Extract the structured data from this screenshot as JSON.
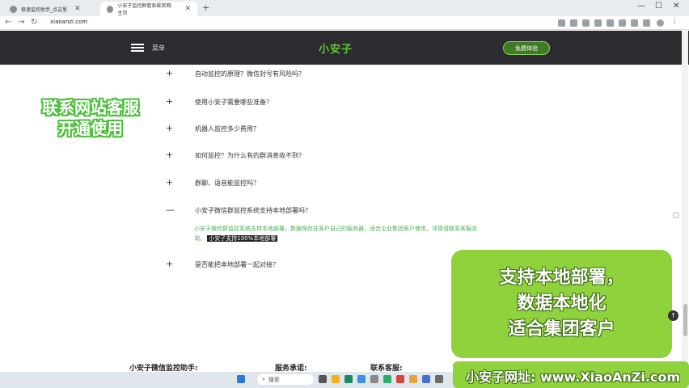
{
  "browser": {
    "tabs": [
      {
        "label": "极速监控助手_点这里"
      },
      {
        "label": "小安子监控群管系统官网-主页"
      }
    ],
    "new_tab": "+",
    "url": "xiaoanzi.com",
    "window_controls": [
      "—",
      "☐",
      "✕"
    ],
    "nav": {
      "back": "←",
      "forward": "→",
      "reload": "↻"
    }
  },
  "header": {
    "menu_label": "菜单",
    "logo": "小安子",
    "cta": "免费体验"
  },
  "faq": [
    {
      "sign": "+",
      "question": "自动监控的原理？微信封号有风险吗？"
    },
    {
      "sign": "+",
      "question": "使用小安子需要哪些准备？"
    },
    {
      "sign": "+",
      "question": "机器人监控多少费用？"
    },
    {
      "sign": "+",
      "question": "如何监控？为什么有的群消息收不到？"
    },
    {
      "sign": "+",
      "question": "群聊、语音能监控吗？"
    },
    {
      "sign": "—",
      "question": "小安子微信群监控系统支持本地部署吗？"
    },
    {
      "sign": "+",
      "question": "是否能把本地部署一起对接？"
    }
  ],
  "answer": {
    "text": "小安子微信群监控系统支持本地部署，数据保存在客户自己的服务器，适合企业集团客户使用，详情请联系客服咨询。",
    "highlight": "小安子支持100%本地部署"
  },
  "promo_left": [
    "联系网站客服",
    "开通使用"
  ],
  "promo_right": [
    "支持本地部署，",
    "数据本地化",
    "适合集团客户"
  ],
  "footer": {
    "col1": "小安子微信监控助手:",
    "col2": "服务承诺:",
    "col3": "联系客服:"
  },
  "taskbar": {
    "search_placeholder": "搜索"
  },
  "url_banner": "小安子网址: www.XiaoAnZi.com",
  "colors": {
    "brand_green": "#5ec634",
    "header_bg": "#2c2c30",
    "promo_green": "#8fd23c"
  }
}
